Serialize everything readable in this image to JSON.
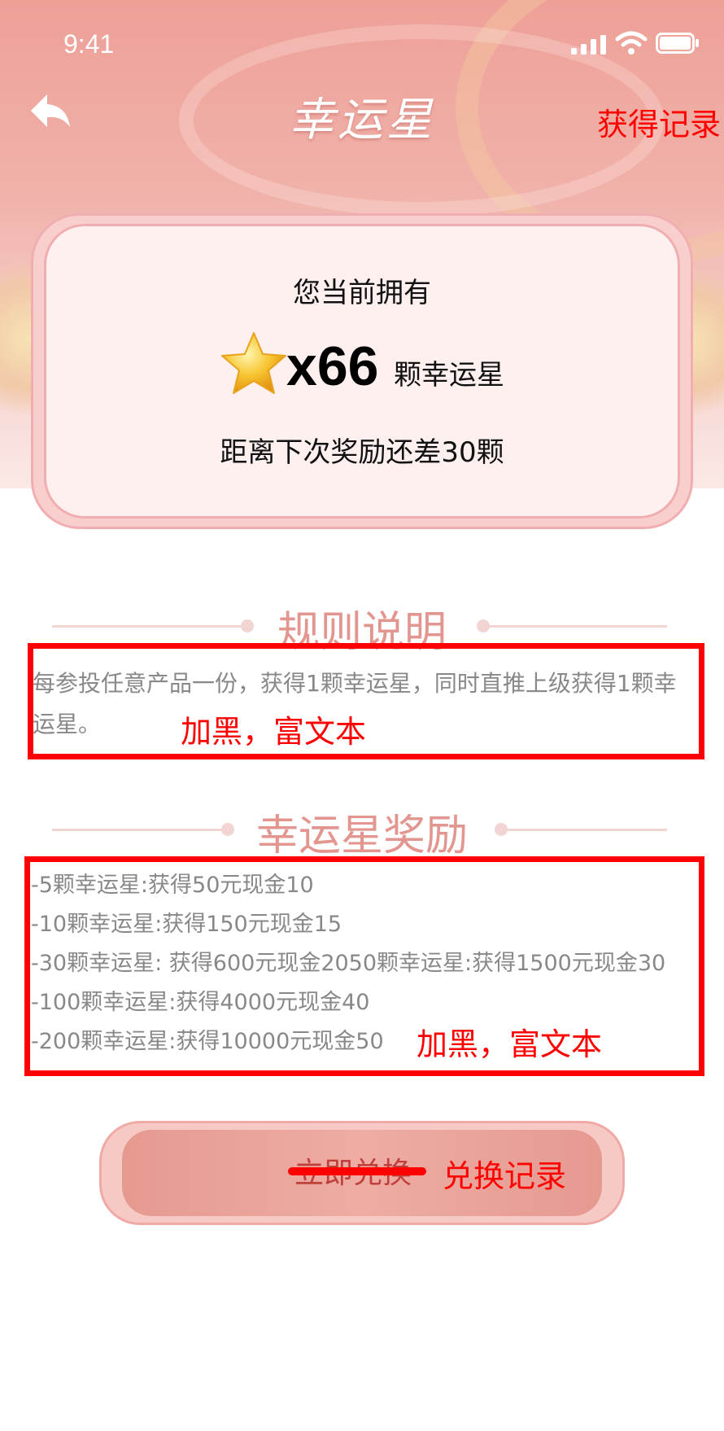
{
  "status_bar": {
    "time": "9:41",
    "icons": [
      "signal-icon",
      "wifi-icon",
      "battery-icon"
    ]
  },
  "nav": {
    "back_icon": "back-arrow-icon",
    "title": "幸运星",
    "right_link": "获得记录"
  },
  "summary": {
    "own_label": "您当前拥有",
    "star_icon": "star-icon",
    "count": "x66",
    "unit": "颗幸运星",
    "next_reward": "距离下次奖励还差30颗"
  },
  "rules": {
    "title": "规则说明",
    "text": "每参投任意产品一份，获得1颗幸运星，同时直推上级获得1颗幸运星。",
    "annotation": "加黑，富文本"
  },
  "rewards": {
    "title": "幸运星奖励",
    "items": [
      "-5颗幸运星:获得50元现金10",
      "-10颗幸运星:获得150元现金15",
      "-30颗幸运星: 获得600元现金2050颗幸运星:获得1500元现金30",
      "-100颗幸运星:获得4000元现金40",
      "-200颗幸运星:获得10000元现金50"
    ],
    "annotation": "加黑，富文本"
  },
  "action_button": {
    "struck_label": "立即兑换",
    "replacement_label": "兑换记录"
  },
  "colors": {
    "header_gradient_top": "#eea097",
    "accent_pink": "#e2968f",
    "annotation_red": "#ff0000",
    "card_border": "#f1aeb0"
  }
}
